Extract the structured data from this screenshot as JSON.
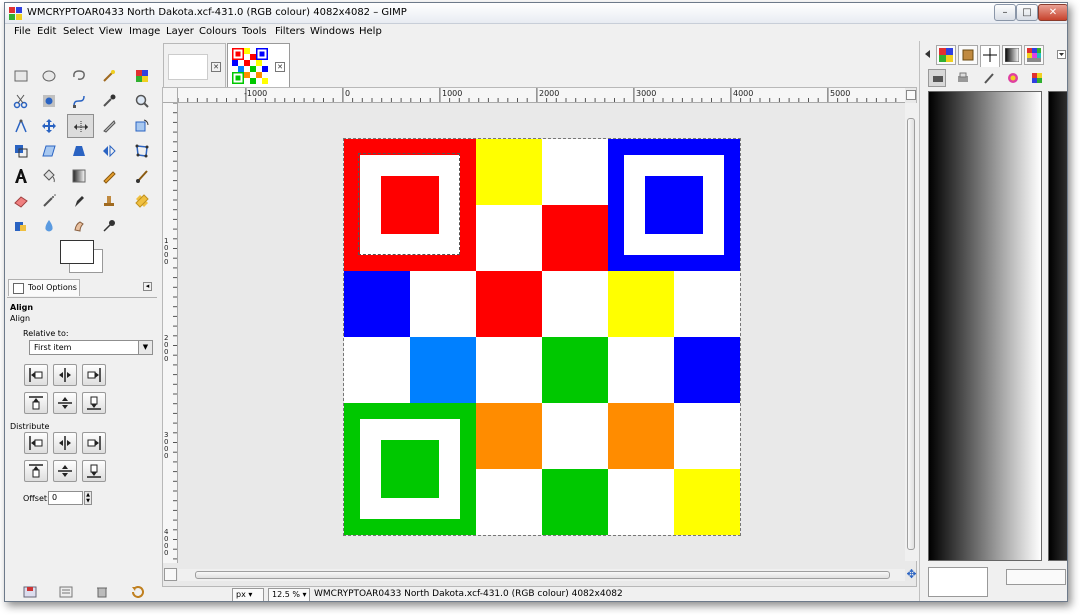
{
  "window": {
    "title": "WMCRYPTOAR0433 North Dakota.xcf-431.0 (RGB colour) 4082x4082 – GIMP",
    "minimize": "–",
    "maximize": "□",
    "close": "✕"
  },
  "menubar": {
    "items": [
      "File",
      "Edit",
      "Select",
      "View",
      "Image",
      "Layer",
      "Colours",
      "Tools",
      "Filters",
      "Windows",
      "Help"
    ]
  },
  "tool_options": {
    "tab_label": "Tool Options",
    "menu_glyph": "◂",
    "title": "Align",
    "subtitle": "Align",
    "relative_to_label": "Relative to:",
    "relative_to_value": "First item",
    "distribute_label": "Distribute",
    "offset_label": "Offset:",
    "offset_value": "0"
  },
  "image_tabs": {
    "close_glyph": "✕"
  },
  "rulers": {
    "h_labels": [
      "-1000",
      "0",
      "1000",
      "2000",
      "3000",
      "4000",
      "5000"
    ],
    "v_labels": [
      "1000",
      "2000",
      "3000",
      "4000"
    ]
  },
  "statusbar": {
    "unit": "px",
    "zoom": "12.5 %",
    "message": "WMCRYPTOAR0433 North Dakota.xcf-431.0 (RGB colour) 4082x4082"
  },
  "image": {
    "grid_size": 6,
    "colors": {
      "red": "#ff0000",
      "yellow": "#ffff00",
      "blue": "#0000ff",
      "green": "#00c800",
      "orange": "#ff8c00",
      "lightblue": "#0080ff",
      "white": "#ffffff"
    },
    "cells": [
      [
        "M",
        "M",
        "yellow",
        "white",
        "M",
        "M"
      ],
      [
        "M",
        "M",
        "white",
        "red",
        "M",
        "M"
      ],
      [
        "blue",
        "white",
        "red",
        "white",
        "yellow",
        "white"
      ],
      [
        "white",
        "lightblue",
        "white",
        "green",
        "white",
        "blue"
      ],
      [
        "M",
        "M",
        "orange",
        "white",
        "orange",
        "white"
      ],
      [
        "M",
        "M",
        "white",
        "green",
        "white",
        "yellow"
      ]
    ],
    "markers": [
      {
        "position": "top-left",
        "color": "red"
      },
      {
        "position": "top-right",
        "color": "blue"
      },
      {
        "position": "bottom-left",
        "color": "green"
      }
    ]
  }
}
